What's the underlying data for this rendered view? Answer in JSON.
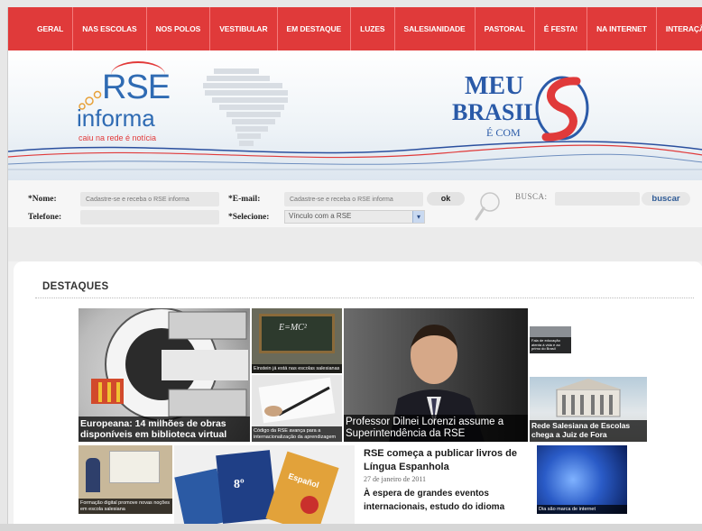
{
  "nav": {
    "items": [
      "GERAL",
      "NAS ESCOLAS",
      "NOS POLOS",
      "VESTIBULAR",
      "EM DESTAQUE",
      "LUZES",
      "SALESIANIDADE",
      "PASTORAL",
      "É FESTA!",
      "NA INTERNET",
      "INTERAÇÃO"
    ]
  },
  "header": {
    "rse_logo": {
      "title": "RSE",
      "subtitle": "informa",
      "tagline": "caiu na rede é notícia"
    },
    "brasil_logo": {
      "line1": "MEU",
      "line2": "BRASIL",
      "line3": "É COM"
    }
  },
  "form": {
    "nome_label": "*Nome:",
    "nome_placeholder": "Cadastre-se e receba o RSE informa",
    "email_label": "*E-mail:",
    "email_placeholder": "Cadastre-se e receba o RSE informa",
    "ok_label": "ok",
    "telefone_label": "Telefone:",
    "selecione_label": "*Selecione:",
    "select_value": "Vínculo com a RSE",
    "busca_label": "BUSCA:",
    "buscar_label": "buscar"
  },
  "destaques": {
    "title": "DESTAQUES",
    "tiles": [
      {
        "caption": "Europeana: 14 milhões de obras disponíveis em biblioteca virtual"
      },
      {
        "caption": "Einstein já está nas escolas salesianas"
      },
      {
        "caption": "Código da RSE avança para a internacionalização da aprendizagem"
      },
      {
        "caption": "Professor Dilnei Lorenzi assume a Superintendência da RSE"
      },
      {
        "caption": "Fala de educação atenta à vida e ao primo do Brasil"
      },
      {
        "caption": "Rede Salesiana de Escolas chega a Juiz de Fora"
      },
      {
        "caption": "Formação digital promove novas noções em escola salesiana"
      },
      {
        "caption": "Dia são marca de internet"
      }
    ],
    "story": {
      "title": "RSE começa a publicar livros de Língua Espanhola",
      "date": "27 de janeiro de 2011",
      "summary": "À espera de grandes eventos internacionais, estudo do idioma"
    },
    "badges": {
      "formula": "E=MC²",
      "book_label": "Español",
      "grade": "8º"
    }
  }
}
